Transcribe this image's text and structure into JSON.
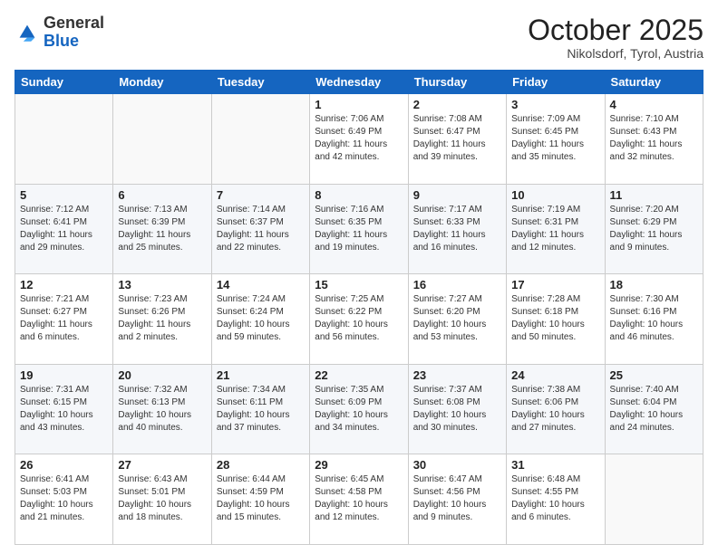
{
  "logo": {
    "general": "General",
    "blue": "Blue"
  },
  "title": "October 2025",
  "location": "Nikolsdorf, Tyrol, Austria",
  "weekdays": [
    "Sunday",
    "Monday",
    "Tuesday",
    "Wednesday",
    "Thursday",
    "Friday",
    "Saturday"
  ],
  "weeks": [
    [
      {
        "day": "",
        "sunrise": "",
        "sunset": "",
        "daylight": ""
      },
      {
        "day": "",
        "sunrise": "",
        "sunset": "",
        "daylight": ""
      },
      {
        "day": "",
        "sunrise": "",
        "sunset": "",
        "daylight": ""
      },
      {
        "day": "1",
        "sunrise": "Sunrise: 7:06 AM",
        "sunset": "Sunset: 6:49 PM",
        "daylight": "Daylight: 11 hours and 42 minutes."
      },
      {
        "day": "2",
        "sunrise": "Sunrise: 7:08 AM",
        "sunset": "Sunset: 6:47 PM",
        "daylight": "Daylight: 11 hours and 39 minutes."
      },
      {
        "day": "3",
        "sunrise": "Sunrise: 7:09 AM",
        "sunset": "Sunset: 6:45 PM",
        "daylight": "Daylight: 11 hours and 35 minutes."
      },
      {
        "day": "4",
        "sunrise": "Sunrise: 7:10 AM",
        "sunset": "Sunset: 6:43 PM",
        "daylight": "Daylight: 11 hours and 32 minutes."
      }
    ],
    [
      {
        "day": "5",
        "sunrise": "Sunrise: 7:12 AM",
        "sunset": "Sunset: 6:41 PM",
        "daylight": "Daylight: 11 hours and 29 minutes."
      },
      {
        "day": "6",
        "sunrise": "Sunrise: 7:13 AM",
        "sunset": "Sunset: 6:39 PM",
        "daylight": "Daylight: 11 hours and 25 minutes."
      },
      {
        "day": "7",
        "sunrise": "Sunrise: 7:14 AM",
        "sunset": "Sunset: 6:37 PM",
        "daylight": "Daylight: 11 hours and 22 minutes."
      },
      {
        "day": "8",
        "sunrise": "Sunrise: 7:16 AM",
        "sunset": "Sunset: 6:35 PM",
        "daylight": "Daylight: 11 hours and 19 minutes."
      },
      {
        "day": "9",
        "sunrise": "Sunrise: 7:17 AM",
        "sunset": "Sunset: 6:33 PM",
        "daylight": "Daylight: 11 hours and 16 minutes."
      },
      {
        "day": "10",
        "sunrise": "Sunrise: 7:19 AM",
        "sunset": "Sunset: 6:31 PM",
        "daylight": "Daylight: 11 hours and 12 minutes."
      },
      {
        "day": "11",
        "sunrise": "Sunrise: 7:20 AM",
        "sunset": "Sunset: 6:29 PM",
        "daylight": "Daylight: 11 hours and 9 minutes."
      }
    ],
    [
      {
        "day": "12",
        "sunrise": "Sunrise: 7:21 AM",
        "sunset": "Sunset: 6:27 PM",
        "daylight": "Daylight: 11 hours and 6 minutes."
      },
      {
        "day": "13",
        "sunrise": "Sunrise: 7:23 AM",
        "sunset": "Sunset: 6:26 PM",
        "daylight": "Daylight: 11 hours and 2 minutes."
      },
      {
        "day": "14",
        "sunrise": "Sunrise: 7:24 AM",
        "sunset": "Sunset: 6:24 PM",
        "daylight": "Daylight: 10 hours and 59 minutes."
      },
      {
        "day": "15",
        "sunrise": "Sunrise: 7:25 AM",
        "sunset": "Sunset: 6:22 PM",
        "daylight": "Daylight: 10 hours and 56 minutes."
      },
      {
        "day": "16",
        "sunrise": "Sunrise: 7:27 AM",
        "sunset": "Sunset: 6:20 PM",
        "daylight": "Daylight: 10 hours and 53 minutes."
      },
      {
        "day": "17",
        "sunrise": "Sunrise: 7:28 AM",
        "sunset": "Sunset: 6:18 PM",
        "daylight": "Daylight: 10 hours and 50 minutes."
      },
      {
        "day": "18",
        "sunrise": "Sunrise: 7:30 AM",
        "sunset": "Sunset: 6:16 PM",
        "daylight": "Daylight: 10 hours and 46 minutes."
      }
    ],
    [
      {
        "day": "19",
        "sunrise": "Sunrise: 7:31 AM",
        "sunset": "Sunset: 6:15 PM",
        "daylight": "Daylight: 10 hours and 43 minutes."
      },
      {
        "day": "20",
        "sunrise": "Sunrise: 7:32 AM",
        "sunset": "Sunset: 6:13 PM",
        "daylight": "Daylight: 10 hours and 40 minutes."
      },
      {
        "day": "21",
        "sunrise": "Sunrise: 7:34 AM",
        "sunset": "Sunset: 6:11 PM",
        "daylight": "Daylight: 10 hours and 37 minutes."
      },
      {
        "day": "22",
        "sunrise": "Sunrise: 7:35 AM",
        "sunset": "Sunset: 6:09 PM",
        "daylight": "Daylight: 10 hours and 34 minutes."
      },
      {
        "day": "23",
        "sunrise": "Sunrise: 7:37 AM",
        "sunset": "Sunset: 6:08 PM",
        "daylight": "Daylight: 10 hours and 30 minutes."
      },
      {
        "day": "24",
        "sunrise": "Sunrise: 7:38 AM",
        "sunset": "Sunset: 6:06 PM",
        "daylight": "Daylight: 10 hours and 27 minutes."
      },
      {
        "day": "25",
        "sunrise": "Sunrise: 7:40 AM",
        "sunset": "Sunset: 6:04 PM",
        "daylight": "Daylight: 10 hours and 24 minutes."
      }
    ],
    [
      {
        "day": "26",
        "sunrise": "Sunrise: 6:41 AM",
        "sunset": "Sunset: 5:03 PM",
        "daylight": "Daylight: 10 hours and 21 minutes."
      },
      {
        "day": "27",
        "sunrise": "Sunrise: 6:43 AM",
        "sunset": "Sunset: 5:01 PM",
        "daylight": "Daylight: 10 hours and 18 minutes."
      },
      {
        "day": "28",
        "sunrise": "Sunrise: 6:44 AM",
        "sunset": "Sunset: 4:59 PM",
        "daylight": "Daylight: 10 hours and 15 minutes."
      },
      {
        "day": "29",
        "sunrise": "Sunrise: 6:45 AM",
        "sunset": "Sunset: 4:58 PM",
        "daylight": "Daylight: 10 hours and 12 minutes."
      },
      {
        "day": "30",
        "sunrise": "Sunrise: 6:47 AM",
        "sunset": "Sunset: 4:56 PM",
        "daylight": "Daylight: 10 hours and 9 minutes."
      },
      {
        "day": "31",
        "sunrise": "Sunrise: 6:48 AM",
        "sunset": "Sunset: 4:55 PM",
        "daylight": "Daylight: 10 hours and 6 minutes."
      },
      {
        "day": "",
        "sunrise": "",
        "sunset": "",
        "daylight": ""
      }
    ]
  ]
}
